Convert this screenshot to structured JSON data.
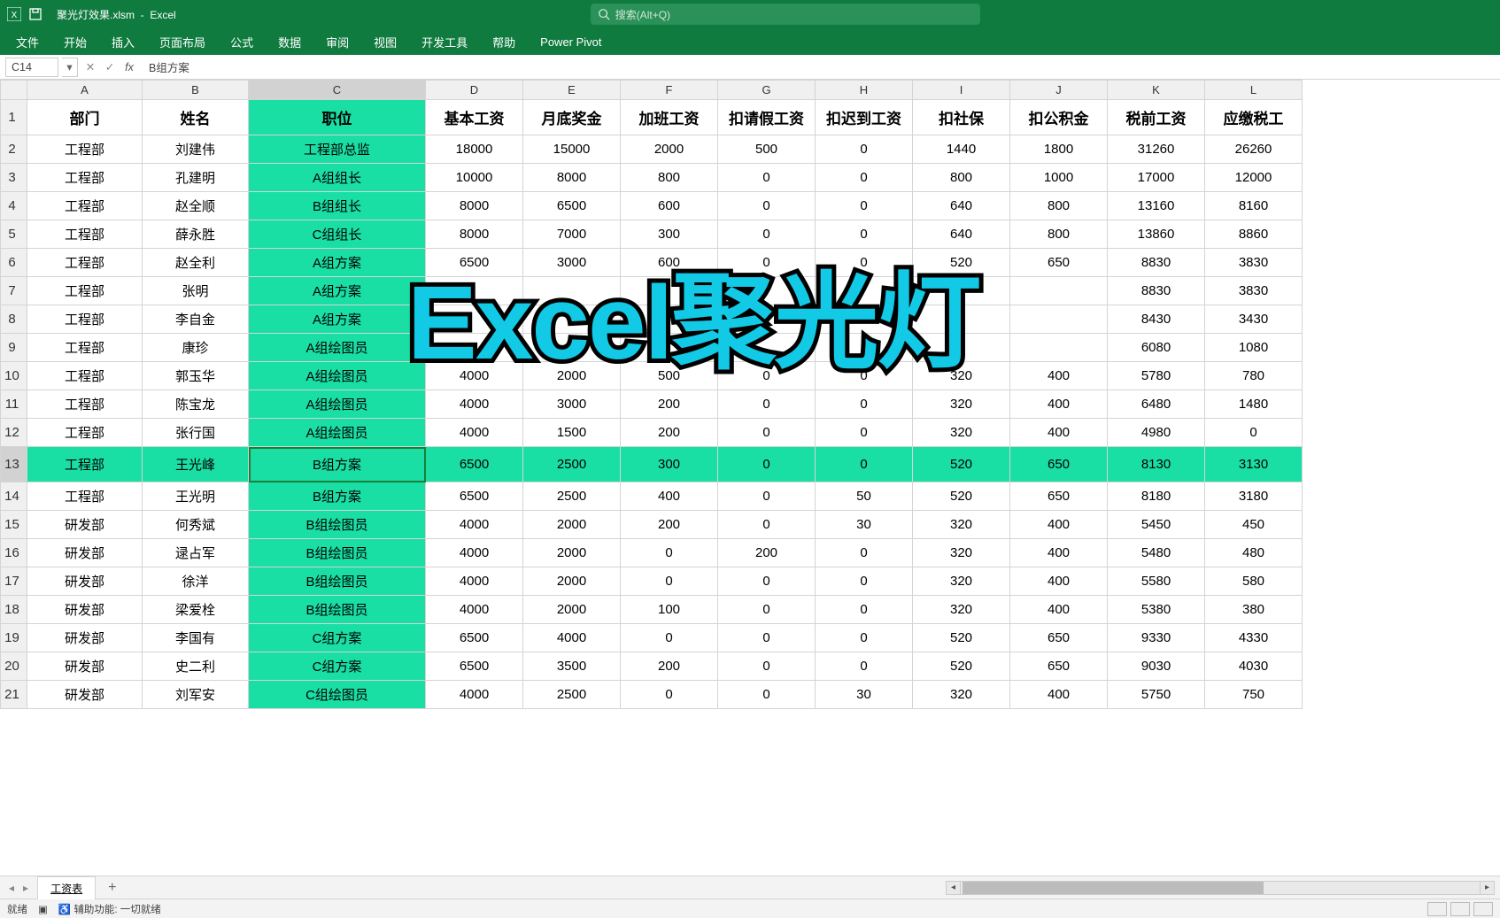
{
  "title_bar": {
    "filename": "聚光灯效果.xlsm",
    "app": "Excel",
    "search_placeholder": "搜索(Alt+Q)"
  },
  "ribbon": [
    "文件",
    "开始",
    "插入",
    "页面布局",
    "公式",
    "数据",
    "审阅",
    "视图",
    "开发工具",
    "帮助",
    "Power Pivot"
  ],
  "formula_bar": {
    "cell_ref": "C14",
    "formula": "B组方案"
  },
  "overlay_text": "Excel聚光灯",
  "columns": [
    "A",
    "B",
    "C",
    "D",
    "E",
    "F",
    "G",
    "H",
    "I",
    "J",
    "K",
    "L"
  ],
  "header_row": [
    "部门",
    "姓名",
    "职位",
    "基本工资",
    "月底奖金",
    "加班工资",
    "扣请假工资",
    "扣迟到工资",
    "扣社保",
    "扣公积金",
    "税前工资",
    "应缴税工"
  ],
  "highlight": {
    "col_index": 2,
    "row_index": 13
  },
  "rows": [
    [
      "工程部",
      "刘建伟",
      "工程部总监",
      "18000",
      "15000",
      "2000",
      "500",
      "0",
      "1440",
      "1800",
      "31260",
      "26260"
    ],
    [
      "工程部",
      "孔建明",
      "A组组长",
      "10000",
      "8000",
      "800",
      "0",
      "0",
      "800",
      "1000",
      "17000",
      "12000"
    ],
    [
      "工程部",
      "赵全顺",
      "B组组长",
      "8000",
      "6500",
      "600",
      "0",
      "0",
      "640",
      "800",
      "13160",
      "8160"
    ],
    [
      "工程部",
      "薛永胜",
      "C组组长",
      "8000",
      "7000",
      "300",
      "0",
      "0",
      "640",
      "800",
      "13860",
      "8860"
    ],
    [
      "工程部",
      "赵全利",
      "A组方案",
      "6500",
      "3000",
      "600",
      "0",
      "0",
      "520",
      "650",
      "8830",
      "3830"
    ],
    [
      "工程部",
      "张明",
      "A组方案",
      "",
      "",
      "",
      "",
      "",
      "",
      "",
      "8830",
      "3830"
    ],
    [
      "工程部",
      "李自金",
      "A组方案",
      "",
      "",
      "",
      "",
      "",
      "",
      "",
      "8430",
      "3430"
    ],
    [
      "工程部",
      "康珍",
      "A组绘图员",
      "",
      "",
      "",
      "",
      "",
      "",
      "",
      "6080",
      "1080"
    ],
    [
      "工程部",
      "郭玉华",
      "A组绘图员",
      "4000",
      "2000",
      "500",
      "0",
      "0",
      "320",
      "400",
      "5780",
      "780"
    ],
    [
      "工程部",
      "陈宝龙",
      "A组绘图员",
      "4000",
      "3000",
      "200",
      "0",
      "0",
      "320",
      "400",
      "6480",
      "1480"
    ],
    [
      "工程部",
      "张行国",
      "A组绘图员",
      "4000",
      "1500",
      "200",
      "0",
      "0",
      "320",
      "400",
      "4980",
      "0"
    ],
    [
      "工程部",
      "王光峰",
      "B组方案",
      "6500",
      "2500",
      "300",
      "0",
      "0",
      "520",
      "650",
      "8130",
      "3130"
    ],
    [
      "工程部",
      "王光明",
      "B组方案",
      "6500",
      "2500",
      "400",
      "0",
      "50",
      "520",
      "650",
      "8180",
      "3180"
    ],
    [
      "研发部",
      "何秀斌",
      "B组绘图员",
      "4000",
      "2000",
      "200",
      "0",
      "30",
      "320",
      "400",
      "5450",
      "450"
    ],
    [
      "研发部",
      "逯占军",
      "B组绘图员",
      "4000",
      "2000",
      "0",
      "200",
      "0",
      "320",
      "400",
      "5480",
      "480"
    ],
    [
      "研发部",
      "徐洋",
      "B组绘图员",
      "4000",
      "2000",
      "0",
      "0",
      "0",
      "320",
      "400",
      "5580",
      "580"
    ],
    [
      "研发部",
      "梁爱栓",
      "B组绘图员",
      "4000",
      "2000",
      "100",
      "0",
      "0",
      "320",
      "400",
      "5380",
      "380"
    ],
    [
      "研发部",
      "李国有",
      "C组方案",
      "6500",
      "4000",
      "0",
      "0",
      "0",
      "520",
      "650",
      "9330",
      "4330"
    ],
    [
      "研发部",
      "史二利",
      "C组方案",
      "6500",
      "3500",
      "200",
      "0",
      "0",
      "520",
      "650",
      "9030",
      "4030"
    ],
    [
      "研发部",
      "刘军安",
      "C组绘图员",
      "4000",
      "2500",
      "0",
      "0",
      "30",
      "320",
      "400",
      "5750",
      "750"
    ]
  ],
  "sheet_tabs": {
    "active": "工资表"
  },
  "status_bar": {
    "mode": "就绪",
    "assist": "辅助功能: 一切就绪"
  }
}
